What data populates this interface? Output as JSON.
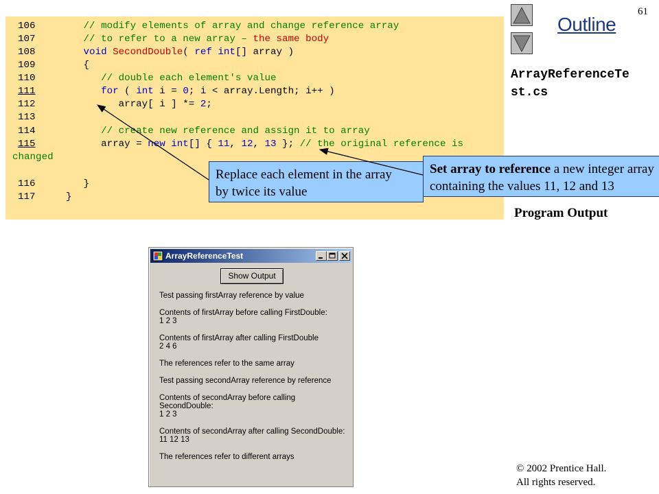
{
  "page_number": "61",
  "outline_title": "Outline",
  "filename_line1": "ArrayReferenceTe",
  "filename_line2": "st.cs",
  "program_output": "Program Output",
  "copyright_line1": "© 2002 Prentice Hall.",
  "copyright_line2": "All rights reserved.",
  "code": {
    "l106": {
      "num": "106",
      "text": "   // modify elements of array and change reference array"
    },
    "l107": {
      "num": "107",
      "text": "   // to refer to a new array – ",
      "red": "the same body"
    },
    "l108": {
      "num": "108",
      "kw": "   void ",
      "name": "SecondDouble",
      "a": "( ",
      "ref": "ref",
      "b": " ",
      "int": "int",
      "c": "[] array )"
    },
    "l109": {
      "num": "109",
      "text": "   {"
    },
    "l110": {
      "num": "110",
      "text": "      // double each element's value"
    },
    "l111": {
      "num": "111",
      "a": "      ",
      "for": "for",
      "b": " ( ",
      "int": "int",
      "c": " i = ",
      "zero": "0",
      "d": "; i < array.Length; i++ )"
    },
    "l112": {
      "num": "112",
      "a": "         array[ i ] *= ",
      "two": "2",
      "b": ";"
    },
    "l113": {
      "num": "113"
    },
    "l114": {
      "num": "114",
      "text": "      // create new reference and assign it to array"
    },
    "l115": {
      "num": "115",
      "a": "      array = ",
      "new": "new",
      "b": " ",
      "int": "int",
      "c": "[] { ",
      "n11": "11",
      "d": ", ",
      "n12": "12",
      "e": ", ",
      "n13": "13",
      "f": " }; ",
      "comment": "// the original reference is"
    },
    "l115b": {
      "text": "changed"
    },
    "l116": {
      "num": "116",
      "text": "   }"
    },
    "l117": {
      "num": "117",
      "text": "}"
    }
  },
  "callout_replace": {
    "line1": "Replace each element in the array",
    "line2": "by twice its value"
  },
  "callout_set": {
    "bold": "Set array to reference",
    "rest": " a new integer array",
    "line2": "containing the values 11, 12 and 13"
  },
  "window": {
    "title": "ArrayReferenceTest",
    "button": "Show Output",
    "output": [
      "Test passing firstArray reference by value",
      "Contents of firstArray before calling FirstDouble:",
      "1 2 3",
      "Contents of firstArray after calling FirstDouble",
      "2 4 6",
      "The references refer to the same array",
      "Test passing secondArray reference by reference",
      "Contents of secondArray before calling",
      "SecondDouble:",
      "1 2 3",
      "Contents of secondArray after calling SecondDouble:",
      "11 12 13",
      "The references refer to different arrays"
    ]
  },
  "colors": {
    "code_bg": "#ffe49a",
    "callout_bg": "#99ccff",
    "comment": "#008000",
    "keyword": "#0000cc",
    "highlight": "#cc0000",
    "outline_link": "#1c3a86"
  }
}
